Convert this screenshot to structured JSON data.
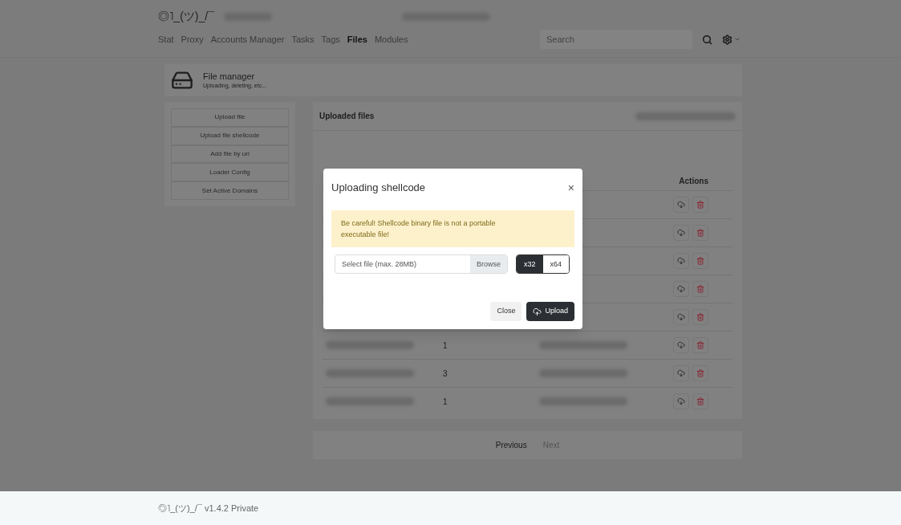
{
  "header": {
    "brand": "◎˥_(ツ)_/¯",
    "nav": [
      {
        "label": "Stat",
        "selected": false
      },
      {
        "label": "Proxy",
        "selected": false
      },
      {
        "label": "Accounts Manager",
        "selected": false
      },
      {
        "label": "Tasks",
        "selected": false
      },
      {
        "label": "Tags",
        "selected": false
      },
      {
        "label": "Files",
        "selected": true
      },
      {
        "label": "Modules",
        "selected": false
      }
    ],
    "search": {
      "placeholder": "Search"
    }
  },
  "page_title": {
    "title": "File manager",
    "subtitle": "Uploading, deleting, etc..."
  },
  "sidebar": {
    "items": [
      "Upload file",
      "Upload file shellcode",
      "Add file by url",
      "Loader Config",
      "Set Active Domains"
    ]
  },
  "files_panel": {
    "title": "Uploaded files",
    "actions_header": "Actions",
    "rows": [
      {},
      {},
      {},
      {},
      {},
      {
        "column_2": "1"
      },
      {
        "column_2": "3"
      },
      {
        "column_2": "1"
      }
    ]
  },
  "pagination": [
    {
      "label": "Previous",
      "disabled": false
    },
    {
      "label": "Next",
      "disabled": true
    }
  ],
  "modal": {
    "title": "Uploading shellcode",
    "close_glyph": "×",
    "warning": "Be careful! Shellcode binary file is not a portable executable file!",
    "file_placeholder": "Select file (max. 28MB)",
    "browse": "Browse",
    "arch": [
      {
        "label": "x32",
        "selected": true
      },
      {
        "label": "x64",
        "selected": false
      }
    ],
    "buttons": {
      "close": "Close",
      "upload": "Upload"
    }
  },
  "footer": "◎˥_(ツ)_/¯ v1.4.2 Private"
}
